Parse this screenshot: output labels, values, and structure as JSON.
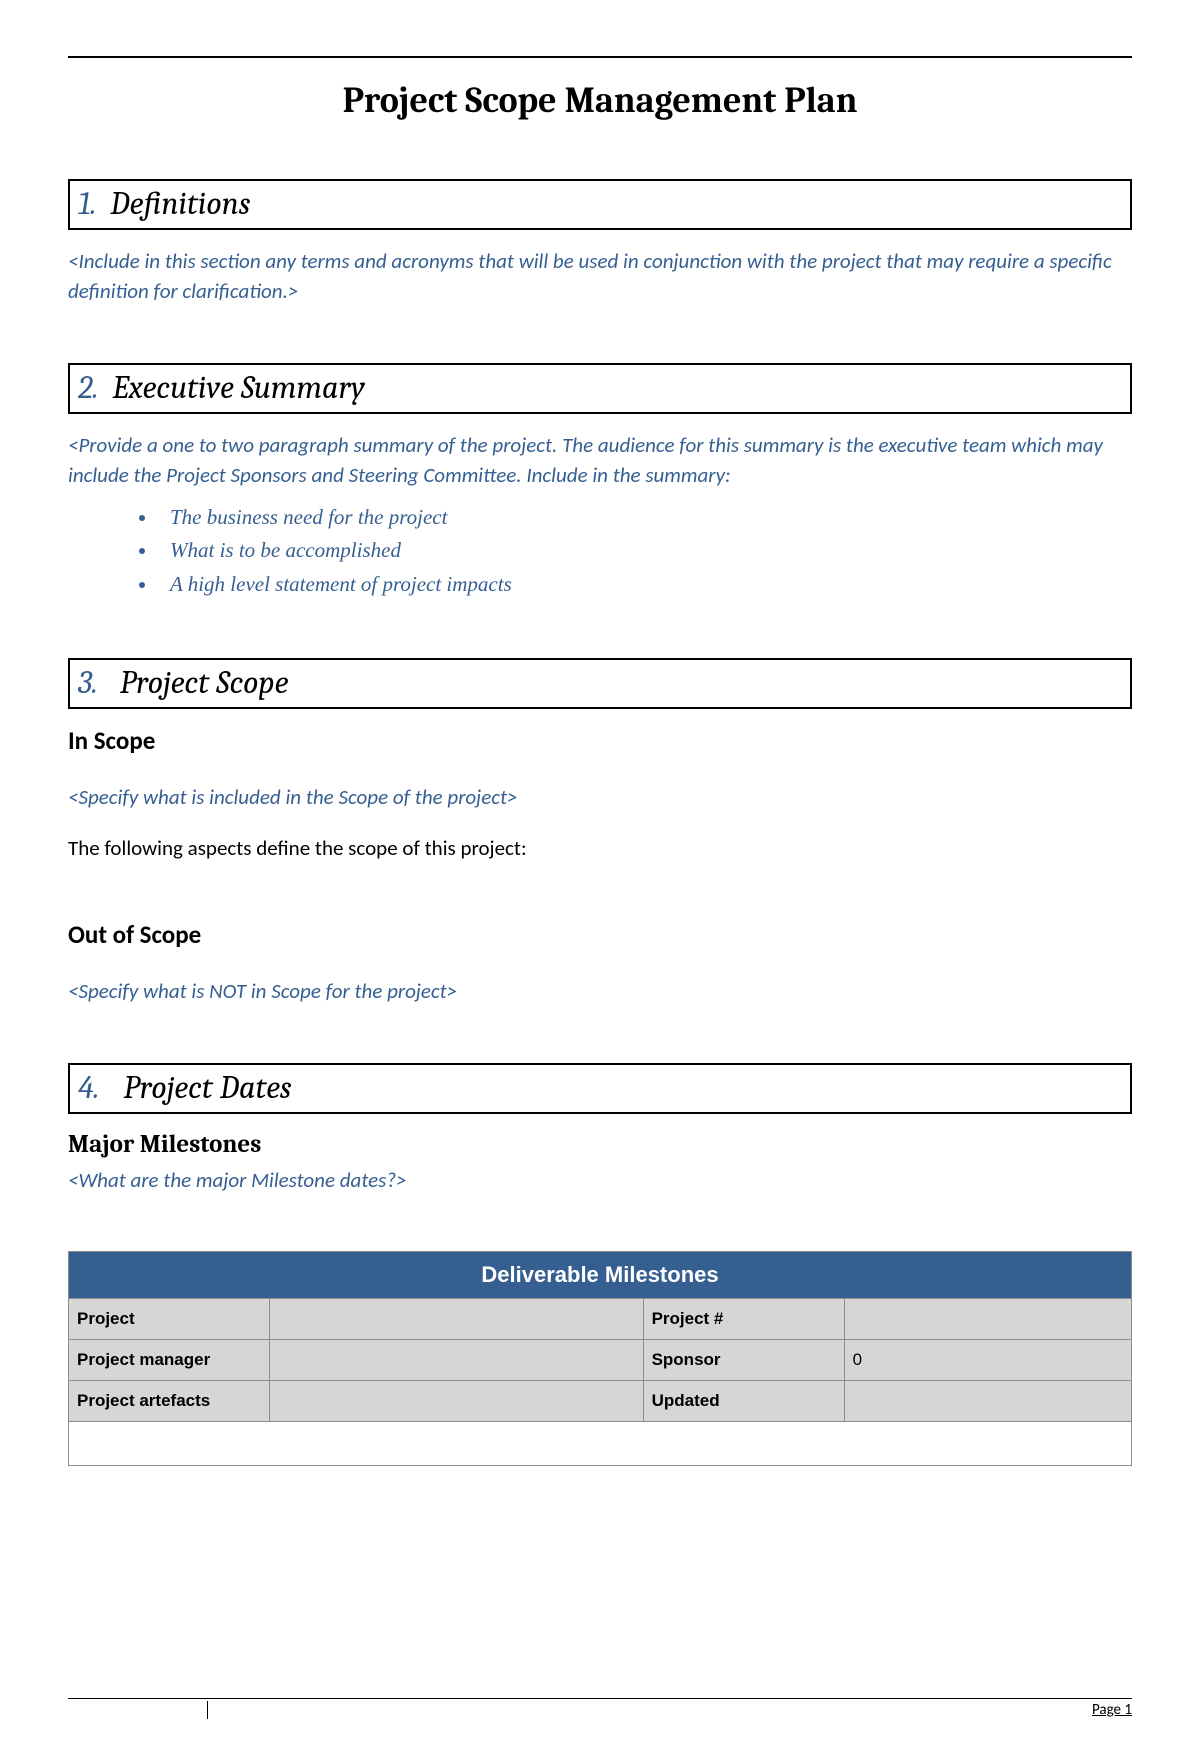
{
  "document": {
    "title": "Project Scope Management Plan"
  },
  "sections": {
    "definitions": {
      "number": "1.",
      "title": "Definitions",
      "instruction": "<Include in this section any terms and acronyms that will be used in conjunction with the project that may require a specific definition for clarification.>"
    },
    "executive_summary": {
      "number": "2.",
      "title": "Executive Summary",
      "instruction": "<Provide a one to two paragraph summary of the project.  The audience for this summary is the executive team which may include the Project Sponsors and Steering Committee.  Include in the summary:",
      "bullets": [
        "The business need for the project",
        "What is to be accomplished",
        "A high level statement of project impacts"
      ]
    },
    "project_scope": {
      "number": "3.",
      "title": "Project Scope",
      "in_scope": {
        "heading": "In Scope",
        "instruction": "<Specify what is included in the Scope of the project>",
        "body": "The following aspects define the scope of this project:"
      },
      "out_of_scope": {
        "heading": "Out of Scope",
        "instruction": "<Specify what is NOT in Scope for the project>"
      }
    },
    "project_dates": {
      "number": "4.",
      "title": "Project Dates",
      "milestones": {
        "heading": "Major Milestones",
        "instruction": "<What are the major Milestone dates?>"
      }
    }
  },
  "table": {
    "header": "Deliverable Milestones",
    "rows": [
      {
        "label1": "Project",
        "value1": "",
        "label2": "Project #",
        "value2": ""
      },
      {
        "label1": "Project manager",
        "value1": "",
        "label2": "Sponsor",
        "value2": "0"
      },
      {
        "label1": "Project artefacts",
        "value1": "",
        "label2": "Updated",
        "value2": ""
      }
    ]
  },
  "footer": {
    "page": "Page 1"
  }
}
